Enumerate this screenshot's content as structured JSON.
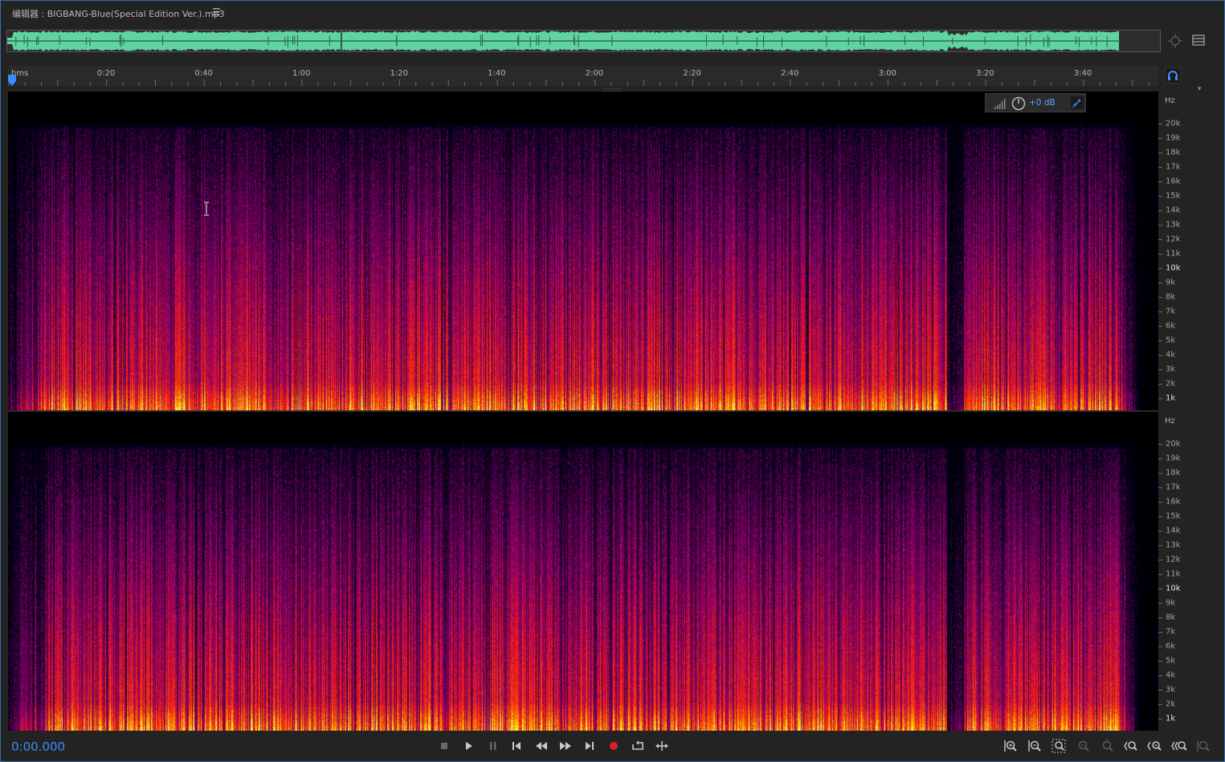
{
  "editor": {
    "title": "编辑器 : BIGBANG-Blue(Special Edition Ver.).mp3",
    "menu_icon": "hamburger-menu-icon"
  },
  "colors": {
    "waveform": "#5fd4a0",
    "accent": "#3d8bff",
    "record": "#e02020",
    "hud_value": "#5fa0ff"
  },
  "ruler": {
    "unit_label": "hms",
    "ticks": [
      "0:20",
      "0:40",
      "1:00",
      "1:20",
      "1:40",
      "2:00",
      "2:20",
      "2:40",
      "3:00",
      "3:20",
      "3:40"
    ]
  },
  "frequency_scale": {
    "unit": "Hz",
    "labels": [
      "20k",
      "19k",
      "18k",
      "17k",
      "16k",
      "15k",
      "14k",
      "13k",
      "12k",
      "11k",
      "10k",
      "9k",
      "8k",
      "7k",
      "6k",
      "5k",
      "4k",
      "3k",
      "2k",
      "1k"
    ]
  },
  "hud": {
    "gain_value": "+0 dB",
    "level_icon": "signal-level-icon",
    "knob_icon": "gain-knob-icon",
    "pin_icon": "pin-icon"
  },
  "transport": {
    "timecode": "0:00.000",
    "buttons": [
      "stop",
      "play",
      "pause",
      "go-to-start",
      "rewind",
      "fast-forward",
      "go-to-end",
      "record",
      "loop",
      "skip-selection"
    ]
  },
  "zoom_controls": [
    "zoom-in-amplitude",
    "zoom-out-amplitude",
    "zoom-reset",
    "zoom-out-full",
    "zoom-in-time",
    "zoom-out-time",
    "zoom-in-left",
    "zoom-in-right",
    "zoom-selection",
    "zoom-fit"
  ]
}
